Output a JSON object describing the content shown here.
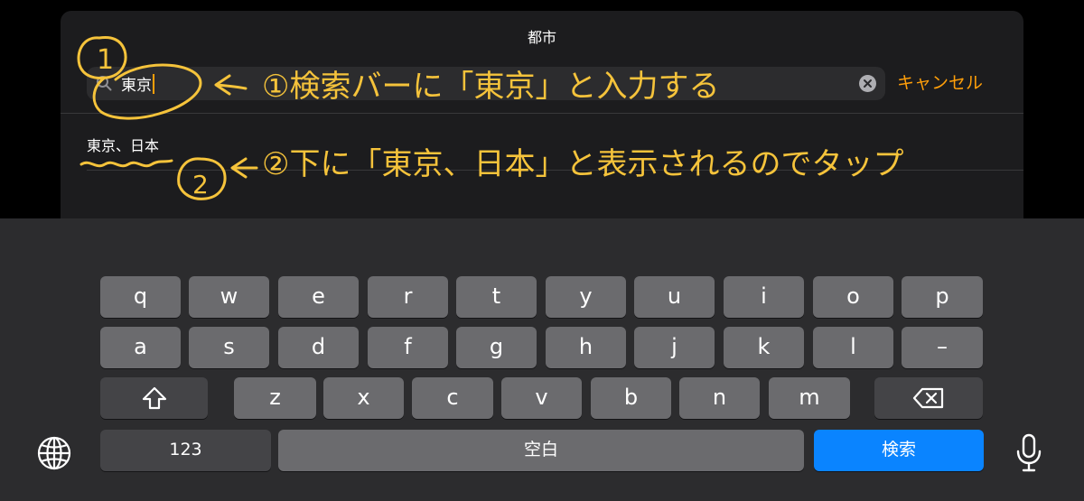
{
  "sheet": {
    "title": "都市",
    "search": {
      "value": "東京",
      "icon": "search-icon",
      "clear_icon": "clear-icon"
    },
    "cancel_label": "キャンセル",
    "results": [
      "東京、日本"
    ]
  },
  "annotations": {
    "step1": "①検索バーに「東京」と入力する",
    "step2": "②下に「東京、日本」と表示されるのでタップ",
    "marker1": "1",
    "marker2": "2",
    "color": "#f5c33b"
  },
  "keyboard": {
    "row1": [
      "q",
      "w",
      "e",
      "r",
      "t",
      "y",
      "u",
      "i",
      "o",
      "p"
    ],
    "row2": [
      "a",
      "s",
      "d",
      "f",
      "g",
      "h",
      "j",
      "k",
      "l",
      "–"
    ],
    "row3": [
      "z",
      "x",
      "c",
      "v",
      "b",
      "n",
      "m"
    ],
    "shift_icon": "shift-icon",
    "delete_icon": "delete-icon",
    "numbers_label": "123",
    "space_label": "空白",
    "search_label": "検索",
    "globe_icon": "globe-icon",
    "mic_icon": "microphone-icon",
    "accent_color": "#0a84ff"
  }
}
